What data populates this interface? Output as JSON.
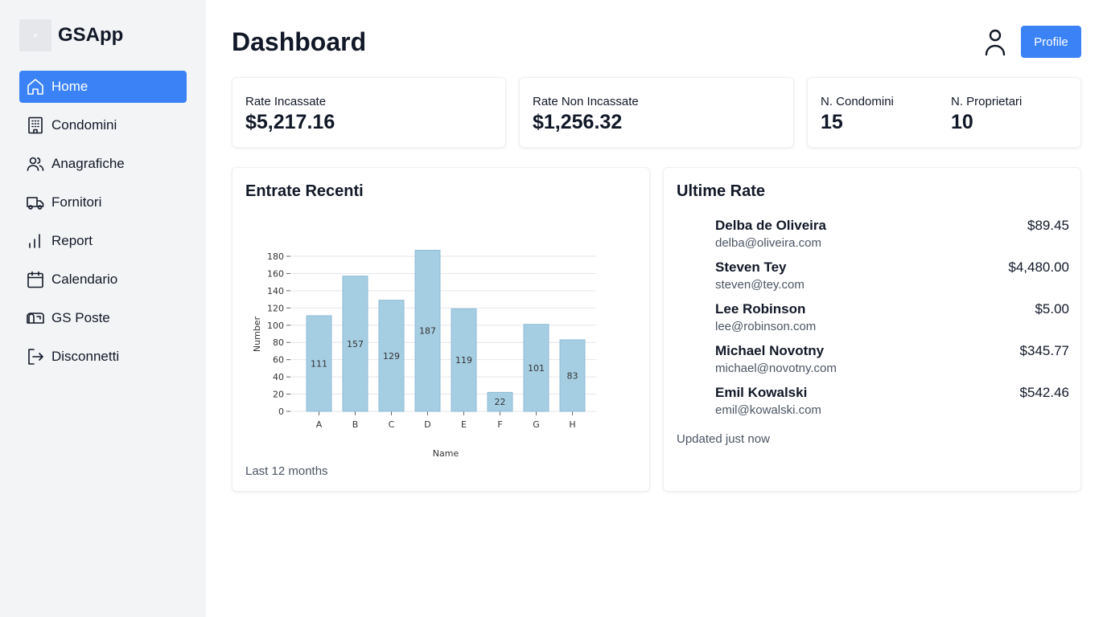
{
  "sidebar": {
    "app_name": "GSApp",
    "items": [
      {
        "label": "Home",
        "icon": "home-icon",
        "active": true
      },
      {
        "label": "Condomini",
        "icon": "building-icon",
        "active": false
      },
      {
        "label": "Anagrafiche",
        "icon": "users-icon",
        "active": false
      },
      {
        "label": "Fornitori",
        "icon": "truck-icon",
        "active": false
      },
      {
        "label": "Report",
        "icon": "bar-chart-icon",
        "active": false
      },
      {
        "label": "Calendario",
        "icon": "calendar-icon",
        "active": false
      },
      {
        "label": "GS Poste",
        "icon": "mailbox-icon",
        "active": false
      },
      {
        "label": "Disconnetti",
        "icon": "logout-icon",
        "active": false
      }
    ]
  },
  "header": {
    "title": "Dashboard",
    "profile_label": "Profile"
  },
  "stats": {
    "rate_incassate": {
      "label": "Rate Incassate",
      "value": "$5,217.16"
    },
    "rate_non_incassate": {
      "label": "Rate Non Incassate",
      "value": "$1,256.32"
    },
    "n_condomini": {
      "label": "N. Condomini",
      "value": "15"
    },
    "n_proprietari": {
      "label": "N. Proprietari",
      "value": "10"
    }
  },
  "entrate": {
    "title": "Entrate Recenti",
    "footer": "Last 12 months"
  },
  "chart_data": {
    "type": "bar",
    "categories": [
      "A",
      "B",
      "C",
      "D",
      "E",
      "F",
      "G",
      "H"
    ],
    "values": [
      111,
      157,
      129,
      187,
      119,
      22,
      101,
      83
    ],
    "xlabel": "Name",
    "ylabel": "Number",
    "ylim": [
      0,
      180
    ],
    "yticks": [
      0,
      20,
      40,
      60,
      80,
      100,
      120,
      140,
      160,
      180
    ],
    "grid": true,
    "bar_color": "#a6cee3",
    "data_labels": true
  },
  "ultime_rate": {
    "title": "Ultime Rate",
    "rows": [
      {
        "name": "Delba de Oliveira",
        "email": "delba@oliveira.com",
        "amount": "$89.45"
      },
      {
        "name": "Steven Tey",
        "email": "steven@tey.com",
        "amount": "$4,480.00"
      },
      {
        "name": "Lee Robinson",
        "email": "lee@robinson.com",
        "amount": "$5.00"
      },
      {
        "name": "Michael Novotny",
        "email": "michael@novotny.com",
        "amount": "$345.77"
      },
      {
        "name": "Emil Kowalski",
        "email": "emil@kowalski.com",
        "amount": "$542.46"
      }
    ],
    "footer": "Updated just now"
  },
  "colors": {
    "accent": "#3b82f6",
    "sidebar_bg": "#f3f4f6"
  }
}
